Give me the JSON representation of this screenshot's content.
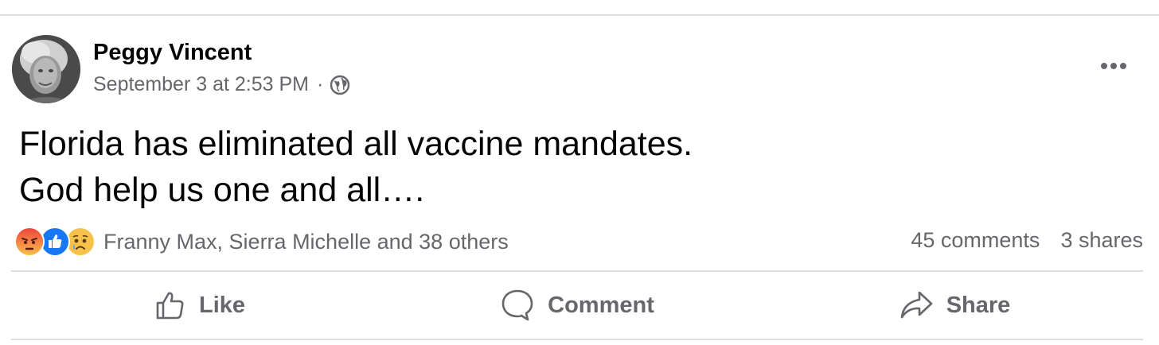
{
  "post": {
    "author": "Peggy Vincent",
    "timestamp": "September 3 at 2:53 PM",
    "separator": "·",
    "privacy_icon": "globe-icon",
    "text_line_1": "Florida has eliminated all vaccine mandates.",
    "text_line_2": "God help us one and all…."
  },
  "reactions": {
    "icons": [
      "angry-reaction-icon",
      "like-reaction-icon",
      "sad-reaction-icon"
    ],
    "summary": "Franny Max, Sierra Michelle and 38 others"
  },
  "counts": {
    "comments": "45 comments",
    "shares": "3 shares"
  },
  "actions": {
    "like": "Like",
    "comment": "Comment",
    "share": "Share"
  },
  "colors": {
    "secondary_text": "#65676b",
    "like_blue": "#1877f2",
    "divider": "#dadde1"
  }
}
